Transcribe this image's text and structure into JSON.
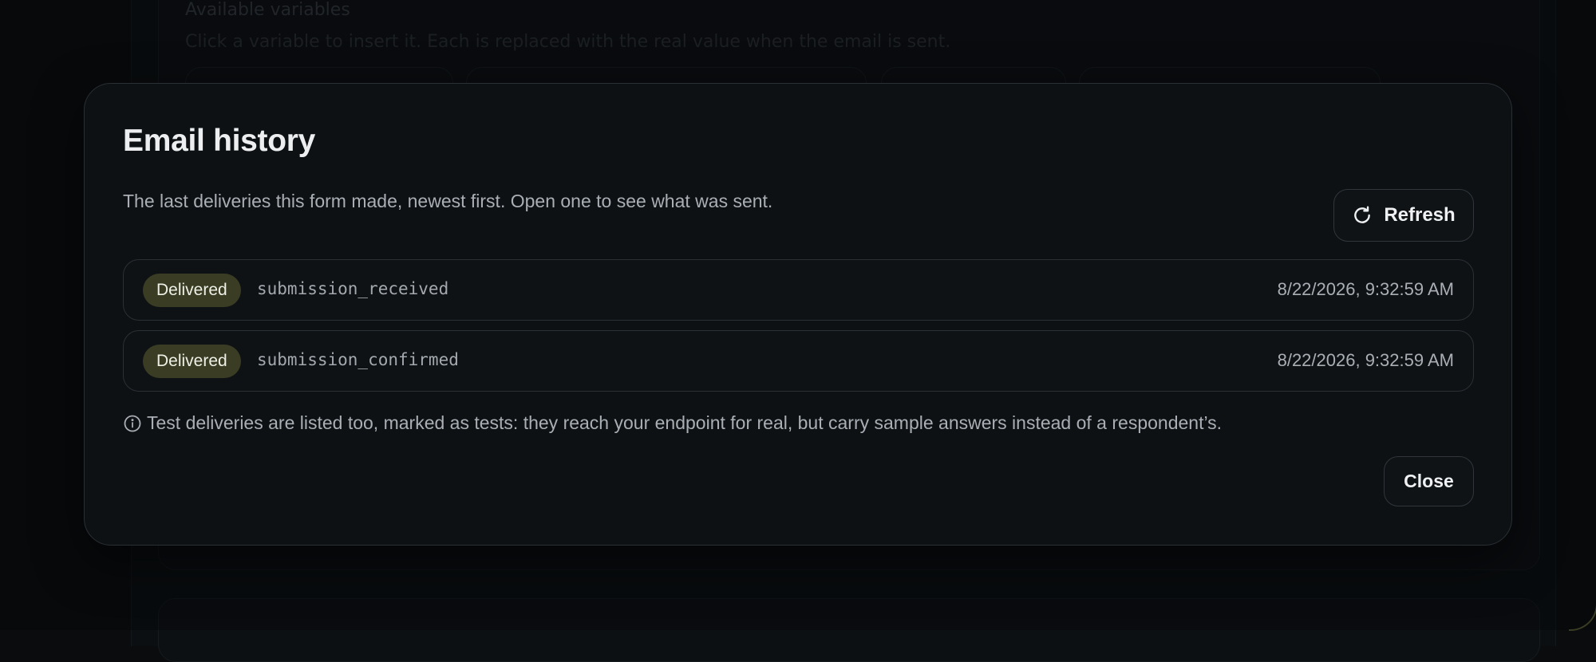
{
  "background": {
    "section_title": "Available variables",
    "section_subtitle": "Click a variable to insert it. Each is replaced with the real value when the email is sent."
  },
  "modal": {
    "title": "Email history",
    "description": "The last deliveries this form made, newest first. Open one to see what was sent.",
    "refresh_label": "Refresh",
    "deliveries": [
      {
        "status": "Delivered",
        "event": "submission_received",
        "timestamp": "8/22/2026, 9:32:59 AM"
      },
      {
        "status": "Delivered",
        "event": "submission_confirmed",
        "timestamp": "8/22/2026, 9:32:59 AM"
      }
    ],
    "note": "Test deliveries are listed too, marked as tests: they reach your endpoint for real, but carry sample answers instead of a respondent’s.",
    "close_label": "Close"
  },
  "icons": {
    "refresh": "refresh-icon",
    "info": "info-icon"
  },
  "colors": {
    "background": "#0a0c0e",
    "modal_background": "#0d1114",
    "badge_background": "#3a3d24",
    "text_primary": "#eceeef",
    "text_secondary": "#a9afb5"
  }
}
